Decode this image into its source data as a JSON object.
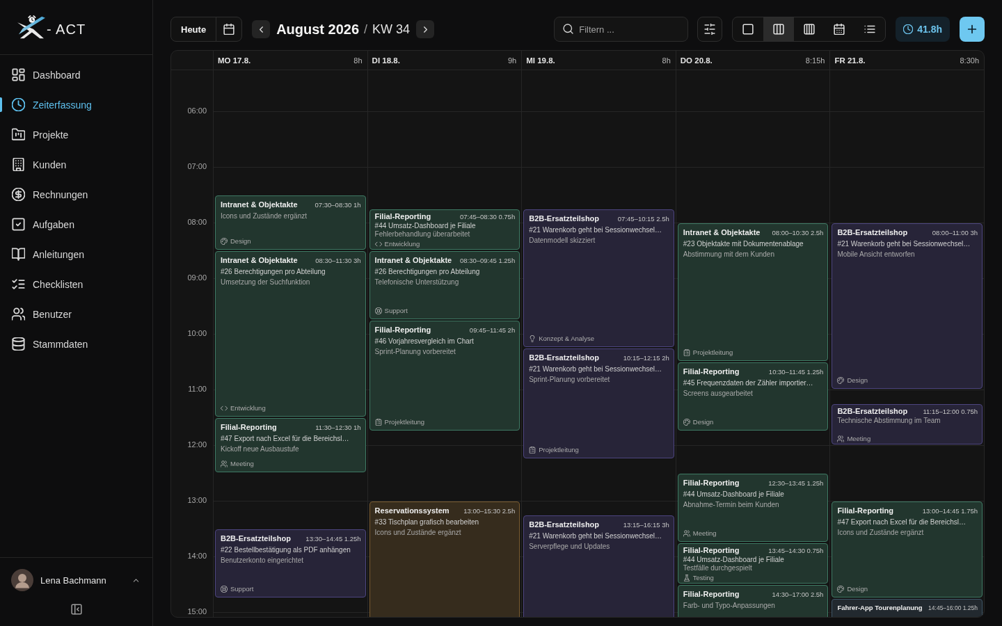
{
  "sidebar": {
    "logo_text": "- ACT",
    "nav": [
      {
        "kind": "dashboard",
        "label": "Dashboard",
        "selected": false
      },
      {
        "kind": "time",
        "label": "Zeiterfassung",
        "selected": true
      },
      {
        "kind": "projects",
        "label": "Projekte",
        "selected": false
      },
      {
        "kind": "customers",
        "label": "Kunden",
        "selected": false
      },
      {
        "kind": "invoices",
        "label": "Rechnungen",
        "selected": false
      },
      {
        "kind": "tasks",
        "label": "Aufgaben",
        "selected": false
      },
      {
        "kind": "guides",
        "label": "Anleitungen",
        "selected": false
      },
      {
        "kind": "checklists",
        "label": "Checklisten",
        "selected": false
      },
      {
        "kind": "users",
        "label": "Benutzer",
        "selected": false
      },
      {
        "kind": "masterdata",
        "label": "Stammdaten",
        "selected": false
      }
    ],
    "user": {
      "name": "Lena Bachmann"
    }
  },
  "toolbar": {
    "today": "Heute",
    "title": "August 2026",
    "separator": "/",
    "week": "KW 34",
    "search": {
      "placeholder": "Filtern ..."
    },
    "views": [
      {
        "kind": "day",
        "selected": false
      },
      {
        "kind": "workweek",
        "selected": true
      },
      {
        "kind": "week",
        "selected": false
      },
      {
        "kind": "month",
        "selected": false
      },
      {
        "kind": "list",
        "selected": false
      }
    ],
    "total_hours": "41.8h"
  },
  "calendar": {
    "hours": [
      "06:00",
      "07:00",
      "08:00",
      "09:00",
      "10:00",
      "11:00",
      "12:00",
      "13:00",
      "14:00",
      "15:00"
    ],
    "days": [
      {
        "label": "MO 17.8.",
        "total": "8h",
        "events": [
          {
            "title": "Intranet & Objektakte",
            "time": "07:30–08:30 1h",
            "note": "Icons und Zustände ergänzt",
            "tag": {
              "kind": "design",
              "label": "Design"
            },
            "color": "#3e7a64"
          },
          {
            "title": "Intranet & Objektakte",
            "time": "08:30–11:30 3h",
            "ticket": "#26 Berechtigungen pro Abteilung",
            "note": "Umsetzung der Suchfunktion",
            "tag": {
              "kind": "development",
              "label": "Entwicklung"
            },
            "color": "#3e7a64"
          },
          {
            "title": "Filial-Reporting",
            "time": "11:30–12:30 1h",
            "ticket": "#47 Export nach Excel für die Bereichsl…",
            "note": "Kickoff neue Ausbaustufe",
            "tag": {
              "kind": "meeting",
              "label": "Meeting"
            },
            "color": "#3e7a64"
          },
          {
            "title": "B2B-Ersatzteilshop",
            "time": "13:30–14:45 1.25h",
            "ticket": "#22 Bestellbestätigung als PDF anhängen",
            "note": "Benutzerkonto eingerichtet",
            "tag": {
              "kind": "support",
              "label": "Support"
            },
            "color": "#4d4580"
          }
        ]
      },
      {
        "label": "DI 18.8.",
        "total": "9h",
        "events": [
          {
            "title": "Filial-Reporting",
            "time": "07:45–08:30 0.75h",
            "ticket": "#44 Umsatz-Dashboard je Filiale",
            "note": "Fehlerbehandlung überarbeitet",
            "tag": {
              "kind": "development",
              "label": "Entwicklung"
            },
            "color": "#3e7a64"
          },
          {
            "title": "Intranet & Objektakte",
            "time": "08:30–09:45 1.25h",
            "ticket": "#26 Berechtigungen pro Abteilung",
            "note": "Telefonische Unterstützung",
            "tag": {
              "kind": "support",
              "label": "Support"
            },
            "color": "#3e7a64"
          },
          {
            "title": "Filial-Reporting",
            "time": "09:45–11:45 2h",
            "ticket": "#46 Vorjahresvergleich im Chart",
            "note": "Sprint-Planung vorbereitet",
            "tag": {
              "kind": "management",
              "label": "Projektleitung"
            },
            "color": "#3e7a64"
          },
          {
            "title": "Reservationssystem",
            "time": "13:00–15:30 2.5h",
            "ticket": "#33 Tischplan grafisch bearbeiten",
            "note": "Icons und Zustände ergänzt",
            "color": "#7a5c30"
          }
        ]
      },
      {
        "label": "MI 19.8.",
        "total": "8h",
        "events": [
          {
            "title": "B2B-Ersatzteilshop",
            "time": "07:45–10:15 2.5h",
            "ticket": "#21 Warenkorb geht bei Sessionwechsel…",
            "note": "Datenmodell skizziert",
            "tag": {
              "kind": "concept",
              "label": "Konzept & Analyse"
            },
            "color": "#4d4580"
          },
          {
            "title": "B2B-Ersatzteilshop",
            "time": "10:15–12:15 2h",
            "ticket": "#21 Warenkorb geht bei Sessionwechsel…",
            "note": "Sprint-Planung vorbereitet",
            "tag": {
              "kind": "management",
              "label": "Projektleitung"
            },
            "color": "#4d4580"
          },
          {
            "title": "B2B-Ersatzteilshop",
            "time": "13:15–16:15 3h",
            "ticket": "#21 Warenkorb geht bei Sessionwechsel…",
            "note": "Serverpflege und Updates",
            "color": "#4d4580"
          }
        ]
      },
      {
        "label": "DO 20.8.",
        "total": "8:15h",
        "events": [
          {
            "title": "Intranet & Objektakte",
            "time": "08:00–10:30 2.5h",
            "ticket": "#23 Objektakte mit Dokumentenablage",
            "note": "Abstimmung mit dem Kunden",
            "tag": {
              "kind": "management",
              "label": "Projektleitung"
            },
            "color": "#3e7a64"
          },
          {
            "title": "Filial-Reporting",
            "time": "10:30–11:45 1.25h",
            "ticket": "#45 Frequenzdaten der Zähler importier…",
            "note": "Screens ausgearbeitet",
            "tag": {
              "kind": "design",
              "label": "Design"
            },
            "color": "#3e7a64"
          },
          {
            "title": "Filial-Reporting",
            "time": "12:30–13:45 1.25h",
            "ticket": "#44 Umsatz-Dashboard je Filiale",
            "note": "Abnahme-Termin beim Kunden",
            "tag": {
              "kind": "meeting",
              "label": "Meeting"
            },
            "color": "#3e7a64"
          },
          {
            "title": "Filial-Reporting",
            "time": "13:45–14:30 0.75h",
            "ticket": "#44 Umsatz-Dashboard je Filiale",
            "note": "Testfälle durchgespielt",
            "tag": {
              "kind": "testing",
              "label": "Testing"
            },
            "color": "#3e7a64"
          },
          {
            "title": "Filial-Reporting",
            "time": "14:30–17:00 2.5h",
            "note": "Farb- und Typo-Anpassungen",
            "color": "#3e7a64"
          }
        ]
      },
      {
        "label": "FR 21.8.",
        "total": "8:30h",
        "events": [
          {
            "title": "B2B-Ersatzteilshop",
            "time": "08:00–11:00 3h",
            "ticket": "#21 Warenkorb geht bei Sessionwechsel…",
            "note": "Mobile Ansicht entworfen",
            "tag": {
              "kind": "design",
              "label": "Design"
            },
            "color": "#4d4580"
          },
          {
            "title": "B2B-Ersatzteilshop",
            "time": "11:15–12:00 0.75h",
            "note": "Technische Abstimmung im Team",
            "tag": {
              "kind": "meeting",
              "label": "Meeting"
            },
            "color": "#4d4580"
          },
          {
            "title": "Filial-Reporting",
            "time": "13:00–14:45 1.75h",
            "ticket": "#47 Export nach Excel für die Bereichsl…",
            "note": "Icons und Zustände ergänzt",
            "tag": {
              "kind": "design",
              "label": "Design"
            },
            "color": "#3e7a64"
          },
          {
            "title": "Fahrer-App Tourenplanung",
            "time": "14:45–16:00 1.25h",
            "color": "#3e5566"
          }
        ]
      }
    ]
  }
}
